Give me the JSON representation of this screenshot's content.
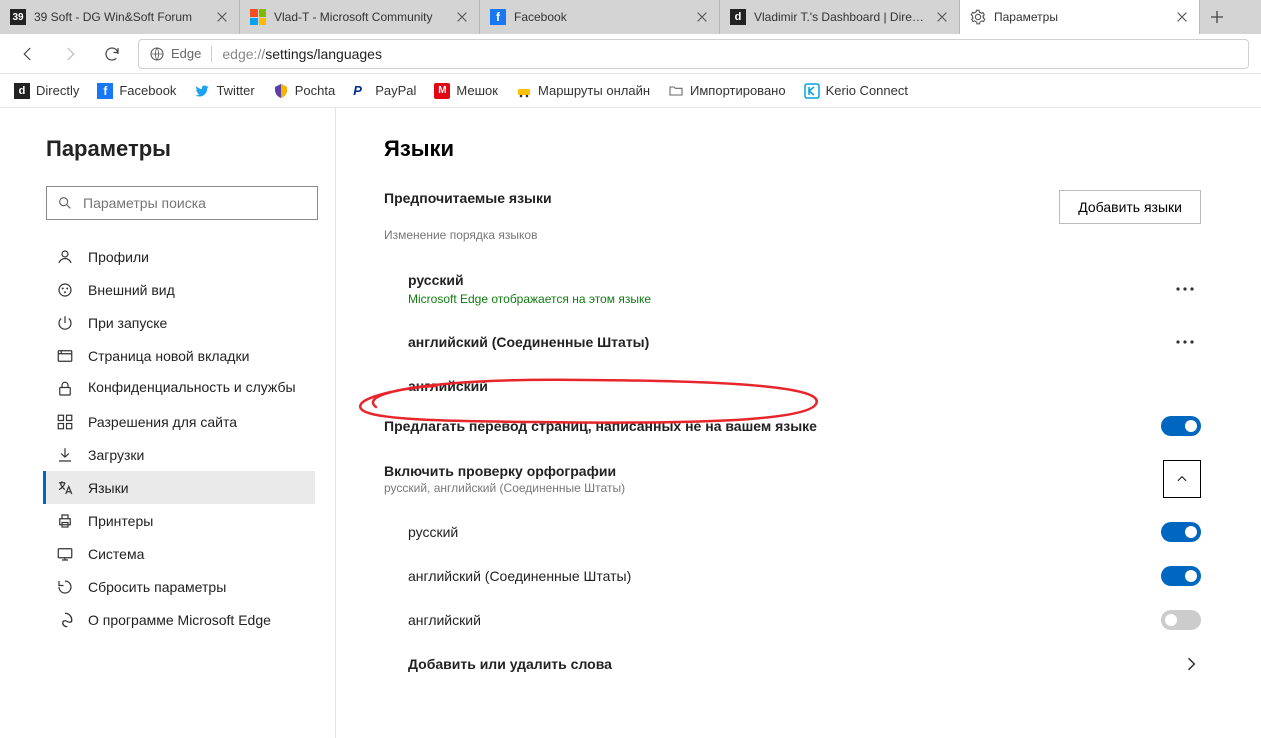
{
  "tabs": [
    {
      "label": "39 Soft - DG Win&Soft Forum"
    },
    {
      "label": "Vlad-T - Microsoft Community"
    },
    {
      "label": "Facebook"
    },
    {
      "label": "Vladimir T.'s Dashboard | Directly"
    },
    {
      "label": "Параметры"
    }
  ],
  "addr": {
    "edge_label": "Edge",
    "url_prefix": "edge://",
    "url_mid": "settings/",
    "url_dark": "languages"
  },
  "bookmarks": [
    {
      "label": "Directly"
    },
    {
      "label": "Facebook"
    },
    {
      "label": "Twitter"
    },
    {
      "label": "Pochta"
    },
    {
      "label": "PayPal"
    },
    {
      "label": "Мешок"
    },
    {
      "label": "Маршруты онлайн"
    },
    {
      "label": "Импортировано"
    },
    {
      "label": "Kerio Connect"
    }
  ],
  "sidebar": {
    "title": "Параметры",
    "search_placeholder": "Параметры поиска",
    "items": [
      {
        "label": "Профили"
      },
      {
        "label": "Внешний вид"
      },
      {
        "label": "При запуске"
      },
      {
        "label": "Страница новой вкладки"
      },
      {
        "label": "Конфиденциальность и службы"
      },
      {
        "label": "Разрешения для сайта"
      },
      {
        "label": "Загрузки"
      },
      {
        "label": "Языки"
      },
      {
        "label": "Принтеры"
      },
      {
        "label": "Система"
      },
      {
        "label": "Сбросить параметры"
      },
      {
        "label": "О программе Microsoft Edge"
      }
    ]
  },
  "main": {
    "heading": "Языки",
    "preferred": {
      "title": "Предпочитаемые языки",
      "subtitle": "Изменение порядка языков",
      "add_button": "Добавить языки",
      "langs": [
        {
          "name": "русский",
          "badge": "Microsoft Edge отображается на этом языке"
        },
        {
          "name": "английский (Соединенные Штаты)"
        },
        {
          "name": "английский"
        }
      ]
    },
    "translate_row": "Предлагать перевод страниц, написанных не на вашем языке",
    "spellcheck": {
      "title": "Включить проверку орфографии",
      "subtitle": "русский, английский (Соединенные Штаты)",
      "langs": [
        {
          "name": "русский",
          "on": true
        },
        {
          "name": "английский (Соединенные Штаты)",
          "on": true
        },
        {
          "name": "английский",
          "on": false
        }
      ],
      "dict_label": "Добавить или удалить слова"
    }
  }
}
